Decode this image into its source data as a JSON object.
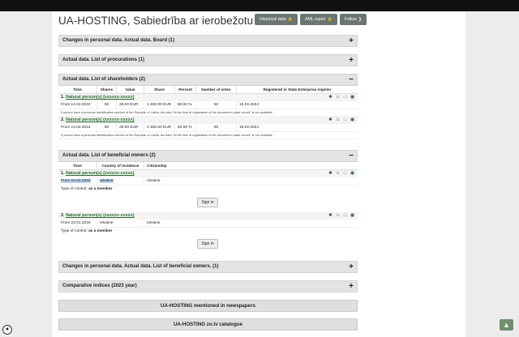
{
  "header": {
    "title": "UA-HOSTING, Sabiedrība ar ierobežotu atbildību",
    "buttons": [
      {
        "label": "Historical data",
        "icon": "lock-icon"
      },
      {
        "label": "AML report",
        "icon": "lock-icon"
      },
      {
        "label": "Follow",
        "icon": "chevron-right-icon"
      }
    ]
  },
  "sections": {
    "board_changes": "Changes in personal data. Actual data. Board (1)",
    "procurations": "Actual data. List of procurations (1)",
    "shareholders": "Actual data. List of shareholders (2)",
    "beneficial": "Actual data. List of beneficial owners (2)",
    "beneficial_changes": "Changes in personal data. Actual data. List of beneficial owners. (1)",
    "indices": "Comparative indices (2023 year)"
  },
  "shareholders": {
    "columns": [
      "Time",
      "Shares",
      "Value",
      "Share",
      "Percent",
      "Number of votes",
      "Registered in State Enterprise register"
    ],
    "people": [
      {
        "index": "1.",
        "name": "Natural person(s) (xxxxxx-xxxxx)",
        "time": "From 14.02.2024",
        "shares": "50",
        "value": "28.00 EUR",
        "share": "1 400.00 EUR",
        "percent": "50.00 %",
        "votes": "50",
        "registered": "16.02.2024",
        "note": "If person have a personal identification number of the Republic of Latvia, the data \"At the time of registration of the document's state record\" is not available."
      },
      {
        "index": "2.",
        "name": "Natural person(s) (xxxxxx-xxxxx)",
        "time": "From 14.02.2024",
        "shares": "50",
        "value": "28.00 EUR",
        "share": "1 400.00 EUR",
        "percent": "50.00 %",
        "votes": "50",
        "registered": "16.02.2024",
        "note": "If person have a personal identification number of the Republic of Latvia, the data \"At the time of registration of the document's state record\" is not available."
      }
    ]
  },
  "beneficial": {
    "columns": [
      "Time",
      "Country of residence",
      "Citizenship"
    ],
    "control_label": "Type of control:",
    "signin_label": "Sign in",
    "people": [
      {
        "index": "1.",
        "name": "Natural person(s) (xxxxxx-xxxxx)",
        "time": "From 16.02.2024",
        "country": "Ukraine",
        "citizenship": "Ukraine",
        "control": "as a member"
      },
      {
        "index": "2.",
        "name": "Natural person(s) (xxxxxx-xxxxx)",
        "time": "From 23.01.2018",
        "country": "Ukraine",
        "citizenship": "Ukraine",
        "control": "as a member"
      }
    ]
  },
  "links": {
    "newspapers": "UA-HOSTING mentioned in newspapers",
    "catalogue": "UA-HOSTING zo.lv catalogue"
  },
  "colors": {
    "accent": "#2a6b2f",
    "button": "#6b7670",
    "section_bg": "#e3e3e3"
  }
}
